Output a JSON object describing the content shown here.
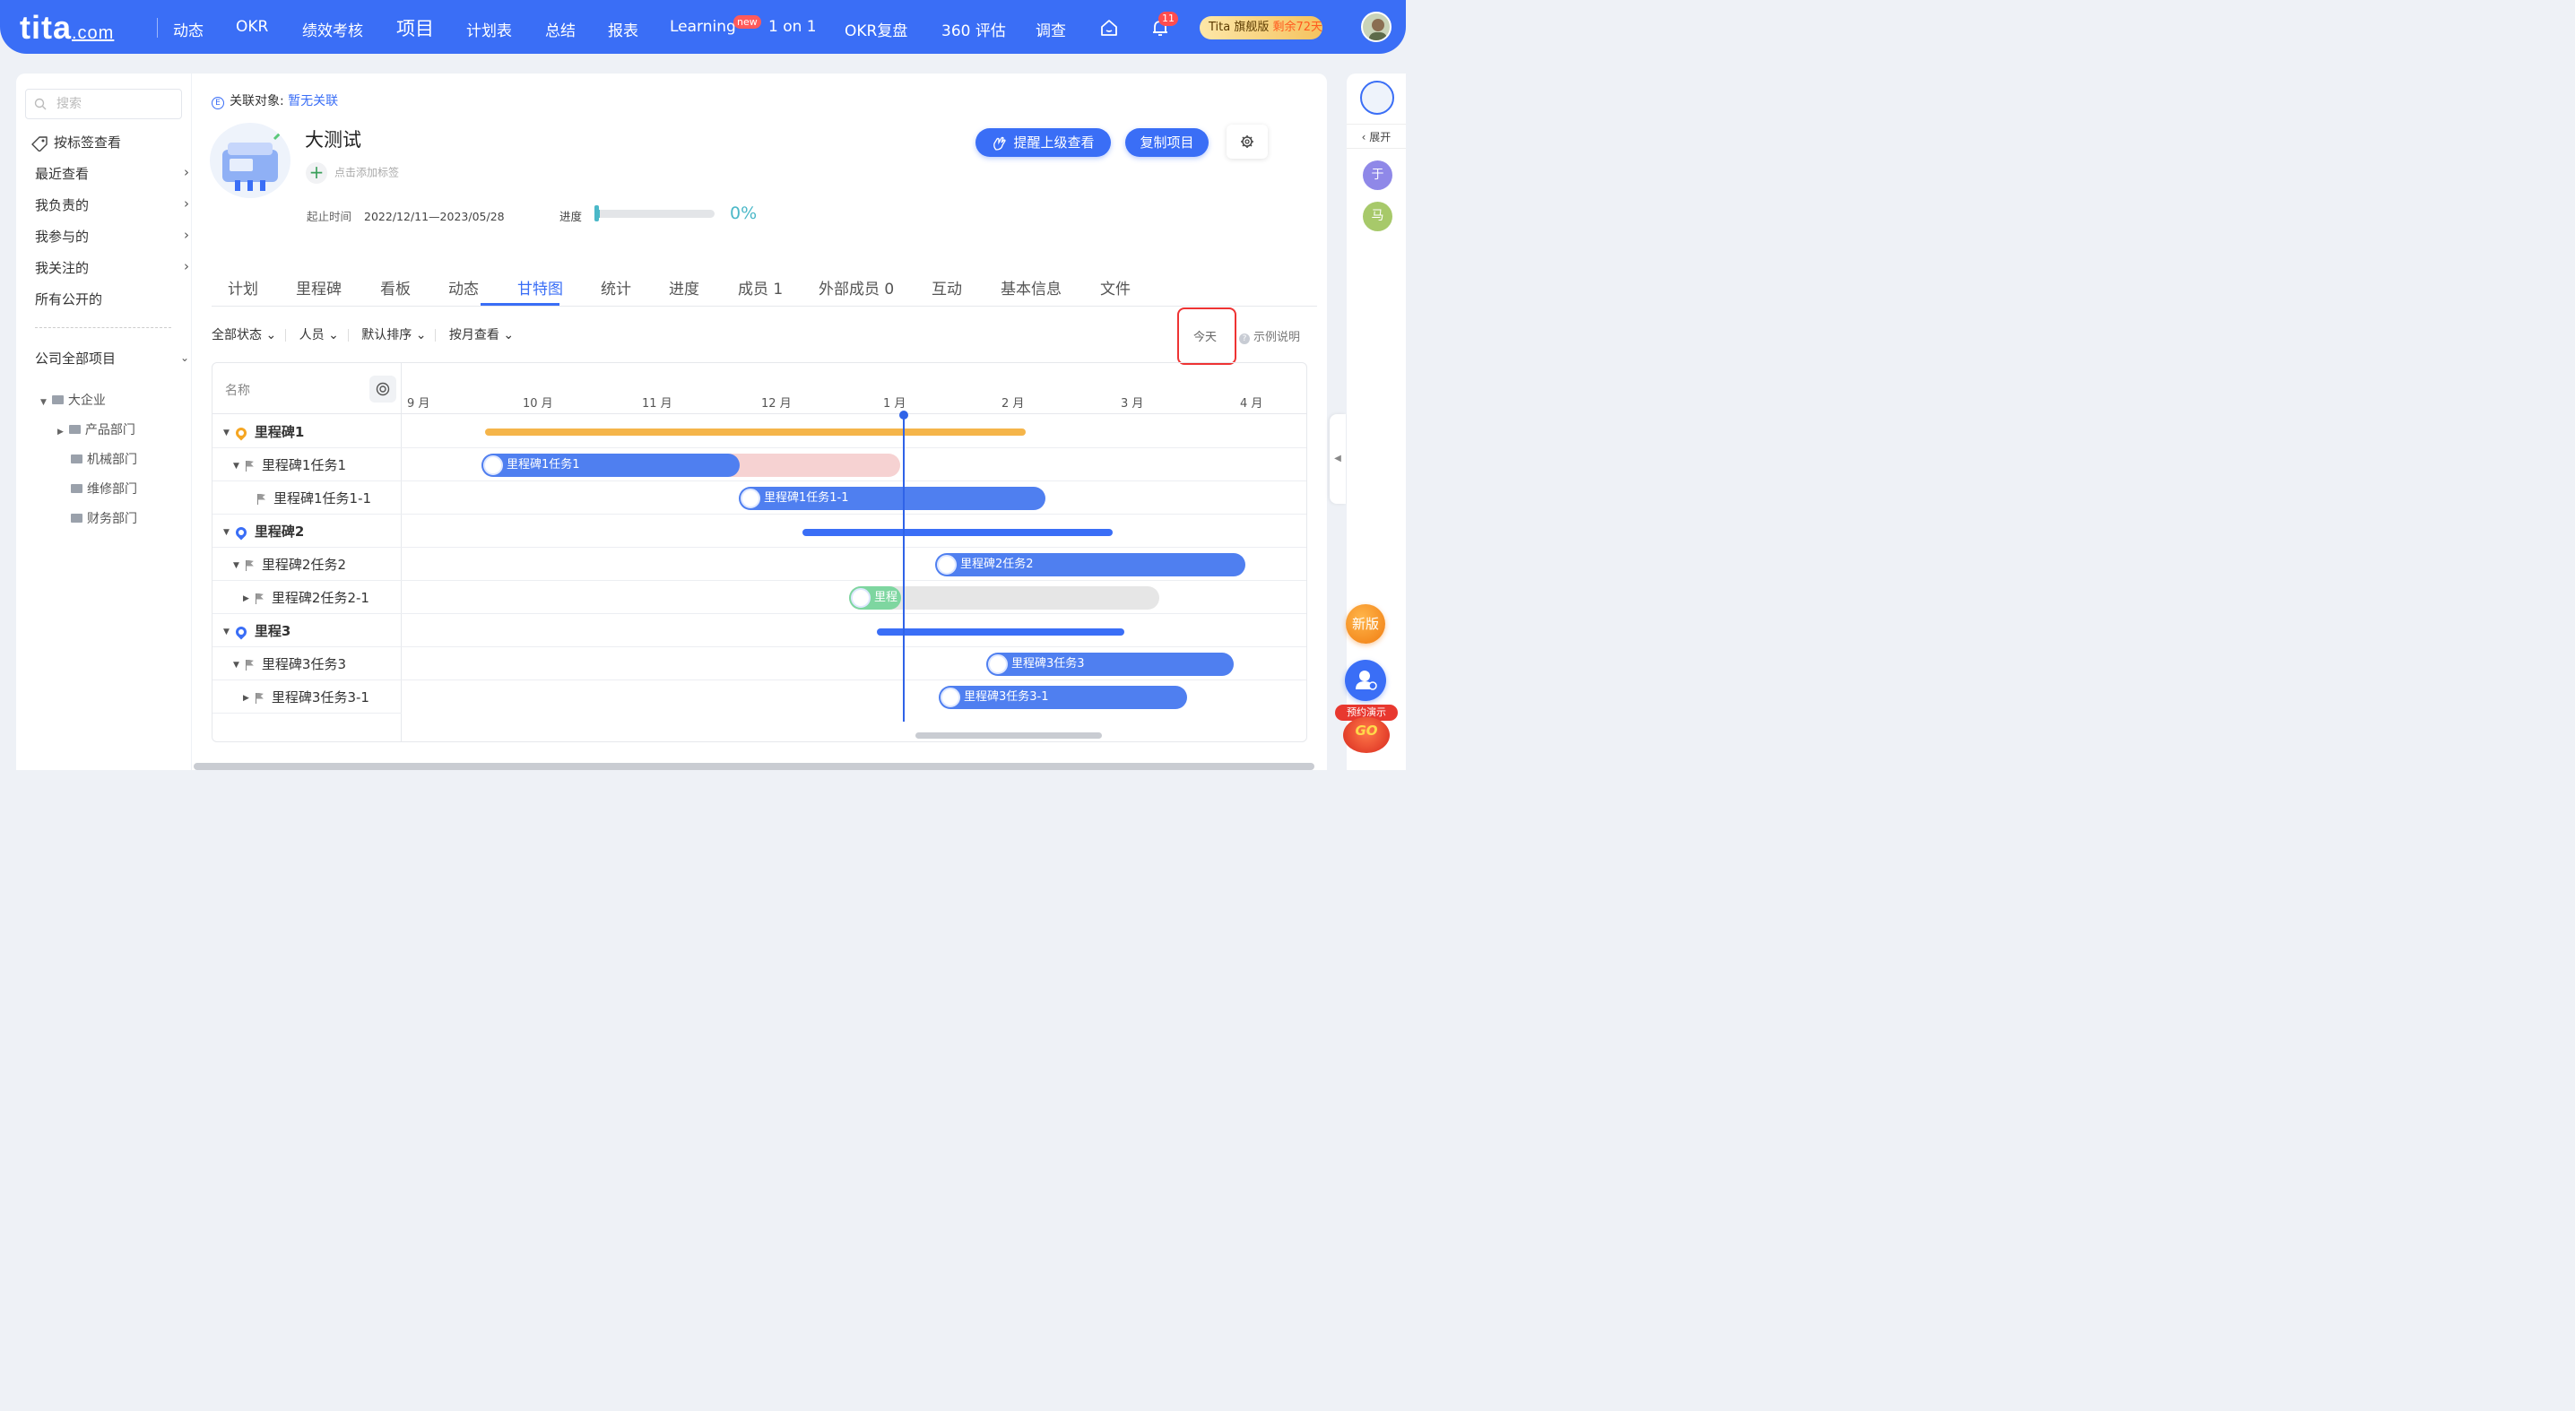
{
  "nav": {
    "logo": "tita",
    "logo_suffix": ".com",
    "items": [
      "动态",
      "OKR",
      "绩效考核",
      "项目",
      "计划表",
      "总结",
      "报表",
      "Learning",
      "1 on 1",
      "OKR复盘",
      "360 评估",
      "调查"
    ],
    "active": "项目",
    "new_badge": "new",
    "notification_count": "11",
    "vip_label": "Tita 旗舰版",
    "vip_remaining": "剩余72天"
  },
  "sidebar": {
    "search_placeholder": "搜索",
    "tag_view": "按标签查看",
    "menu": [
      "最近查看",
      "我负责的",
      "我参与的",
      "我关注的",
      "所有公开的"
    ],
    "company_projects": "公司全部项目",
    "tree": {
      "root": "大企业",
      "children": [
        "产品部门",
        "机械部门",
        "维修部门",
        "财务部门"
      ]
    }
  },
  "project": {
    "related_label": "关联对象:",
    "related_value": "暂无关联",
    "title": "大测试",
    "add_tag": "点击添加标签",
    "period_label": "起止时间",
    "period_value": "2022/12/11—2023/05/28",
    "progress_label": "进度",
    "progress_value": "0%",
    "progress_fraction": 0.04,
    "remind_button": "提醒上级查看",
    "copy_button": "复制项目"
  },
  "tabs": [
    "计划",
    "里程碑",
    "看板",
    "动态",
    "甘特图",
    "统计",
    "进度",
    "成员 1",
    "外部成员 0",
    "互动",
    "基本信息",
    "文件"
  ],
  "active_tab": "甘特图",
  "filters": [
    "全部状态",
    "人员",
    "默认排序",
    "按月查看"
  ],
  "today_button": "今天",
  "legend_button": "示例说明",
  "gantt": {
    "name_header": "名称",
    "months": [
      "9 月",
      "10 月",
      "11 月",
      "12 月",
      "1 月",
      "2 月",
      "3 月",
      "4 月"
    ],
    "rows": [
      {
        "name": "里程碑1",
        "type": "milestone",
        "pin_color": "#f5a623"
      },
      {
        "name": "里程碑1任务1",
        "type": "task",
        "bar_label": "里程碑1任务1"
      },
      {
        "name": "里程碑1任务1-1",
        "type": "subtask",
        "bar_label": "里程碑1任务1-1"
      },
      {
        "name": "里程碑2",
        "type": "milestone",
        "pin_color": "#3a6ef6"
      },
      {
        "name": "里程碑2任务2",
        "type": "task",
        "bar_label": "里程碑2任务2"
      },
      {
        "name": "里程碑2任务2-1",
        "type": "subtask",
        "bar_label": "里程"
      },
      {
        "name": "里程3",
        "type": "milestone",
        "pin_color": "#3a6ef6"
      },
      {
        "name": "里程碑3任务3",
        "type": "task",
        "bar_label": "里程碑3任务3"
      },
      {
        "name": "里程碑3任务3-1",
        "type": "subtask",
        "bar_label": "里程碑3任务3-1"
      }
    ]
  },
  "right_rail": {
    "expand_label": "展开",
    "members": [
      "于",
      "马"
    ],
    "new_version": "新版",
    "demo_label": "预约演示",
    "go_label": "GO"
  },
  "colors": {
    "brand": "#3a6ef6",
    "milestone_orange": "#f5b54a",
    "overdue_pink": "#f6d2d2",
    "done_green": "#7ed6a0",
    "pending_gray": "#e6e6e6"
  }
}
